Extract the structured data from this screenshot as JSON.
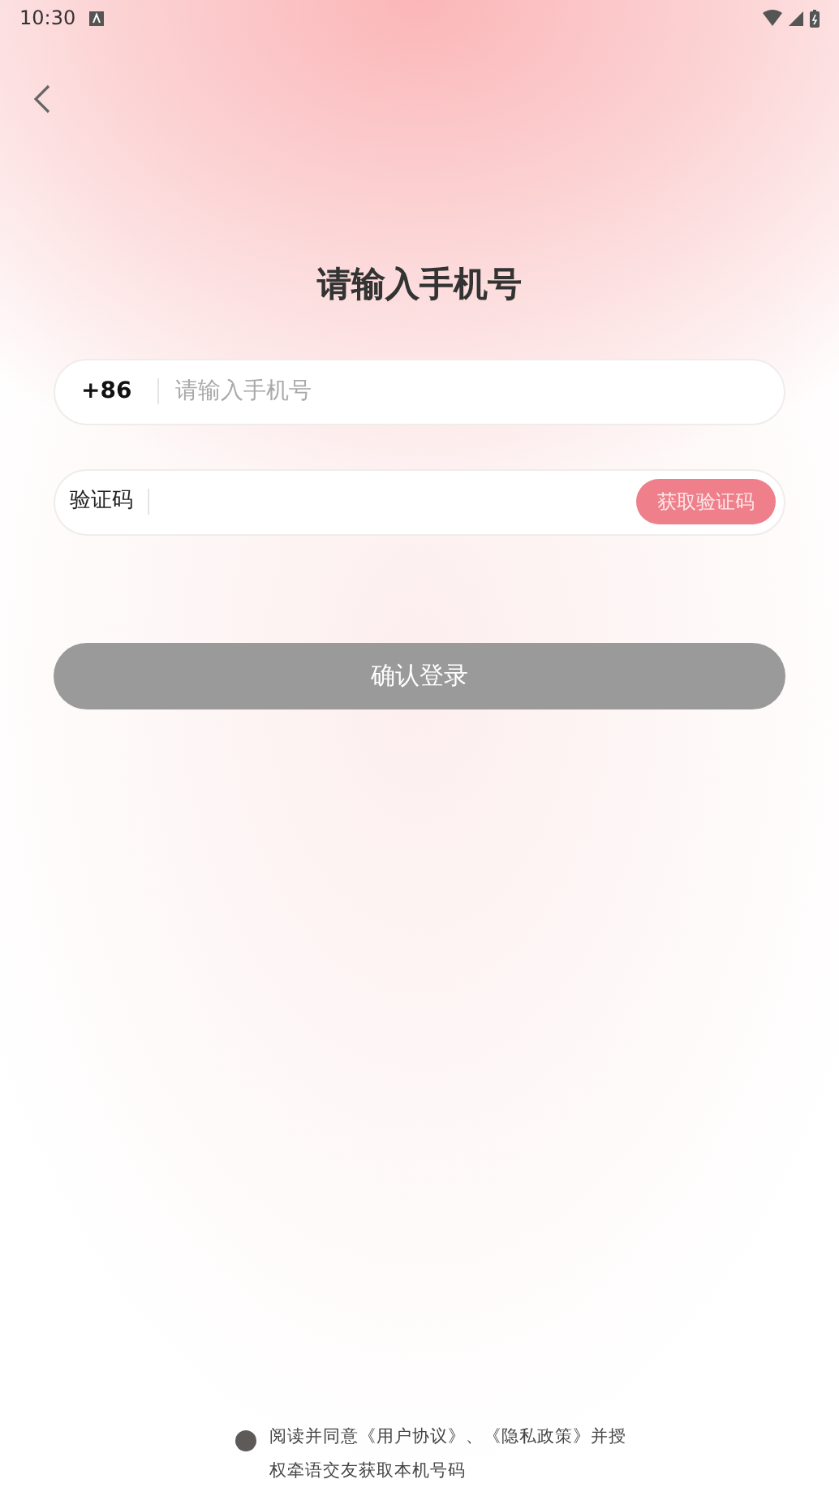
{
  "status_bar": {
    "time": "10:30"
  },
  "title": "请输入手机号",
  "phone": {
    "prefix": "+86",
    "placeholder": "请输入手机号"
  },
  "code": {
    "label": "验证码",
    "button": "获取验证码"
  },
  "login_button": {
    "label": "确认登录",
    "disabled": true
  },
  "agreement": {
    "checked": false,
    "parts": [
      {
        "kind": "text",
        "text": "阅读并同意"
      },
      {
        "kind": "link",
        "text": "《用户协议》"
      },
      {
        "kind": "text",
        "text": "、"
      },
      {
        "kind": "link",
        "text": "《隐私政策》"
      },
      {
        "kind": "text",
        "text": "并授权牵语交友获取本机号码"
      }
    ]
  }
}
